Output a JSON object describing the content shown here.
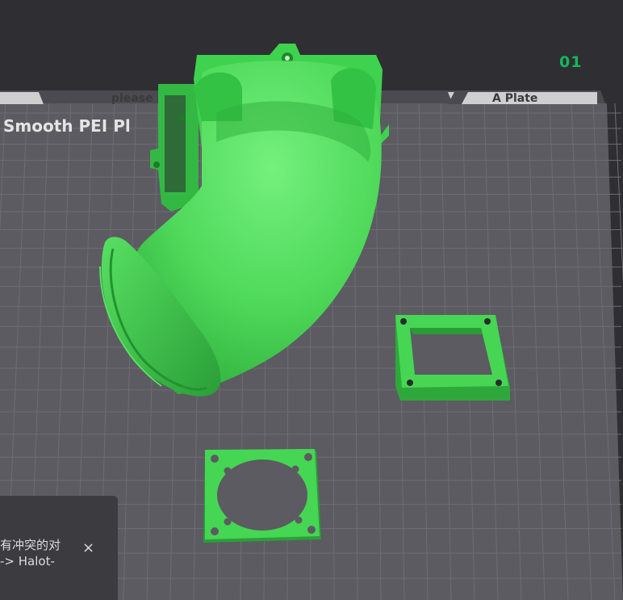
{
  "viewport": {
    "plate_index": "01",
    "name_label_left": "please",
    "name_label_right": "A Plate",
    "plate_type_title": "Smooth PEI Pl"
  },
  "notice": {
    "line1": "有冲突的对",
    "line2": "-> Halot-",
    "close_icon": "×"
  },
  "colors": {
    "model": "#3fd24f",
    "bed": "#5a5a60",
    "grid": "#6c6c72",
    "top_bar": "#2f2f33",
    "accent": "#14b85e"
  },
  "icons": [
    "close-icon"
  ]
}
